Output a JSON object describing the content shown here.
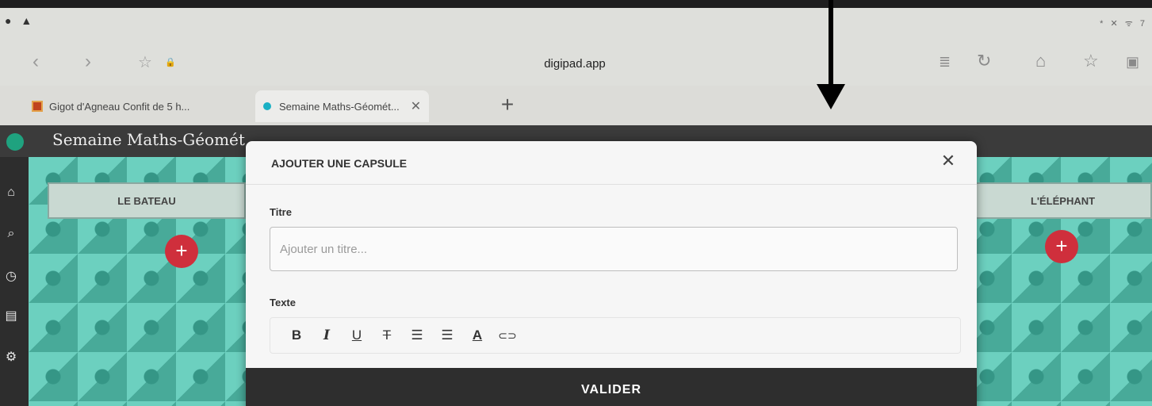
{
  "browser": {
    "status_left": "● ▲",
    "status_right": "* ✕ ᯤ 7",
    "url": "digipad.app",
    "tabs": [
      {
        "label": "Gigot d'Agneau Confit de 5 h..."
      },
      {
        "label": "Semaine Maths-Géomét...",
        "close": "✕"
      }
    ],
    "new_tab": "+",
    "icons": {
      "back": "‹",
      "forward": "›",
      "star": "☆",
      "lock": "🔒",
      "reader": "≣",
      "reload": "↻",
      "home": "⌂",
      "bookmark": "☆",
      "tabs": "▣"
    }
  },
  "pad": {
    "title": "Semaine Maths-Géomét",
    "columns": [
      {
        "label": "LE BATEAU"
      },
      {
        "label": "L'ÉLÉPHANT"
      }
    ],
    "add_symbol": "+"
  },
  "modal": {
    "title": "AJOUTER UNE CAPSULE",
    "close": "✕",
    "title_label": "Titre",
    "title_placeholder": "Ajouter un titre...",
    "text_label": "Texte",
    "toolbar": [
      "B",
      "I",
      "U",
      "T",
      "☰",
      "☰",
      "A",
      "⊂⊃"
    ],
    "validate": "VALIDER"
  }
}
